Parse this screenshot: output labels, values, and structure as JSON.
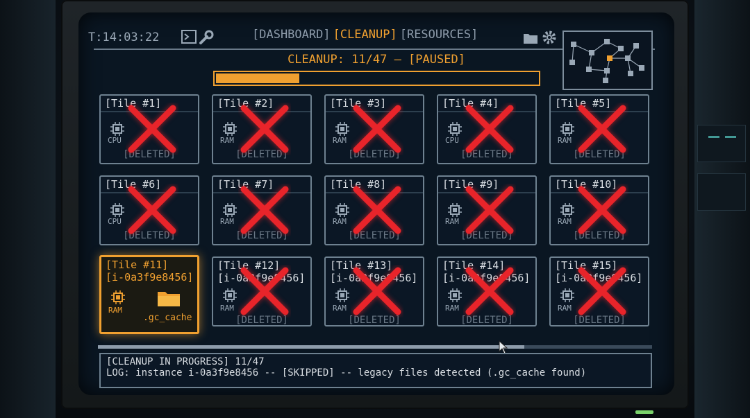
{
  "header": {
    "clock": "T:14:03:22",
    "tabs": [
      {
        "label": "[DASHBOARD]",
        "active": false
      },
      {
        "label": "[CLEANUP]",
        "active": true
      },
      {
        "label": "[RESOURCES]",
        "active": false
      }
    ]
  },
  "status": {
    "title": "CLEANUP: 11/47 — [PAUSED]",
    "progress": 0.26
  },
  "tiles": [
    {
      "title": "[Tile #1]",
      "kind": "CPU",
      "status": "[DELETED]"
    },
    {
      "title": "[Tile #2]",
      "kind": "RAM",
      "status": "[DELETED]"
    },
    {
      "title": "[Tile #3]",
      "kind": "RAM",
      "status": "[DELETED]"
    },
    {
      "title": "[Tile #4]",
      "kind": "CPU",
      "status": "[DELETED]"
    },
    {
      "title": "[Tile #5]",
      "kind": "RAM",
      "status": "[DELETED]"
    },
    {
      "title": "[Tile #6]",
      "kind": "CPU",
      "status": "[DELETED]"
    },
    {
      "title": "[Tile #7]",
      "kind": "RAM",
      "status": "[DELETED]"
    },
    {
      "title": "[Tile #8]",
      "kind": "RAM",
      "status": "[DELETED]"
    },
    {
      "title": "[Tile #9]",
      "kind": "RAM",
      "status": "[DELETED]"
    },
    {
      "title": "[Tile #10]",
      "kind": "RAM",
      "status": "[DELETED]"
    },
    {
      "title": "[Tile #11]",
      "instance": "[i-0a3f9e8456]",
      "kind": "RAM",
      "folder": ".gc_cache",
      "active": true
    },
    {
      "title": "[Tile #12]",
      "instance": "[i-0a3f9e8456]",
      "kind": "RAM",
      "status": "[DELETED]"
    },
    {
      "title": "[Tile #13]",
      "instance": "[i-0a3f9e8456]",
      "kind": "RAM",
      "status": "[DELETED]"
    },
    {
      "title": "[Tile #14]",
      "instance": "[i-0a3f9e8456]",
      "kind": "RAM",
      "status": "[DELETED]"
    },
    {
      "title": "[Tile #15]",
      "instance": "[i-0a3f9e8456]",
      "kind": "RAM",
      "status": "[DELETED]"
    }
  ],
  "scroll": {
    "position": 0.77
  },
  "log": {
    "line1": "[CLEANUP IN PROGRESS] 11/47",
    "line2": "LOG: instance i-0a3f9e8456 -- [SKIPPED] -- legacy files detected (.gc_cache found)"
  },
  "colors": {
    "accent": "#f0a030",
    "delete_mark": "#e8242a"
  },
  "icons": {
    "terminal": "terminal-icon",
    "wrench": "wrench-icon",
    "folder": "folder-icon",
    "gear": "gear-icon",
    "chip": "chip-icon"
  }
}
